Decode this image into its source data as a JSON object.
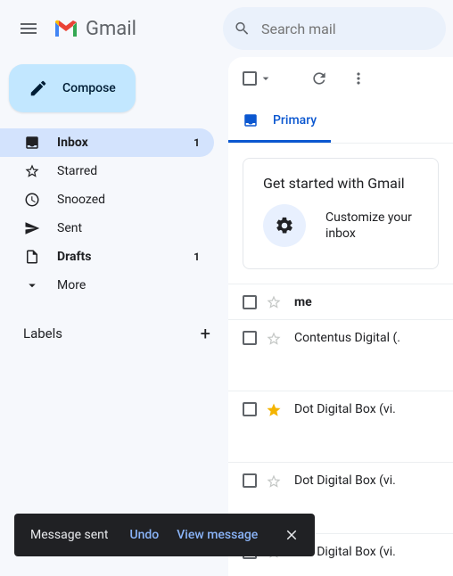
{
  "header": {
    "brand": "Gmail",
    "search_placeholder": "Search mail"
  },
  "compose_label": "Compose",
  "nav": [
    {
      "icon": "inbox",
      "label": "Inbox",
      "count": "1",
      "active": true,
      "bold": true
    },
    {
      "icon": "star",
      "label": "Starred",
      "count": "",
      "active": false,
      "bold": false
    },
    {
      "icon": "clock",
      "label": "Snoozed",
      "count": "",
      "active": false,
      "bold": false
    },
    {
      "icon": "send",
      "label": "Sent",
      "count": "",
      "active": false,
      "bold": false
    },
    {
      "icon": "file",
      "label": "Drafts",
      "count": "1",
      "active": false,
      "bold": true
    },
    {
      "icon": "chevron",
      "label": "More",
      "count": "",
      "active": false,
      "bold": false
    }
  ],
  "labels_head": "Labels",
  "tabs": [
    {
      "label": "Primary",
      "active": true
    }
  ],
  "card": {
    "title": "Get started with Gmail",
    "action_line1": "Customize your",
    "action_line2": "inbox"
  },
  "mails": [
    {
      "sender": "me",
      "starred": false,
      "unread": true,
      "tall": false
    },
    {
      "sender": "Contentus Digital (.",
      "starred": false,
      "unread": false,
      "tall": true
    },
    {
      "sender": "Dot Digital Box (vi.",
      "starred": true,
      "unread": false,
      "tall": true
    },
    {
      "sender": "Dot Digital Box (vi.",
      "starred": false,
      "unread": false,
      "tall": true
    },
    {
      "sender": "Dot Digital Box (vi.",
      "starred": false,
      "unread": false,
      "tall": false
    }
  ],
  "toast": {
    "message": "Message sent",
    "undo": "Undo",
    "view": "View message"
  }
}
